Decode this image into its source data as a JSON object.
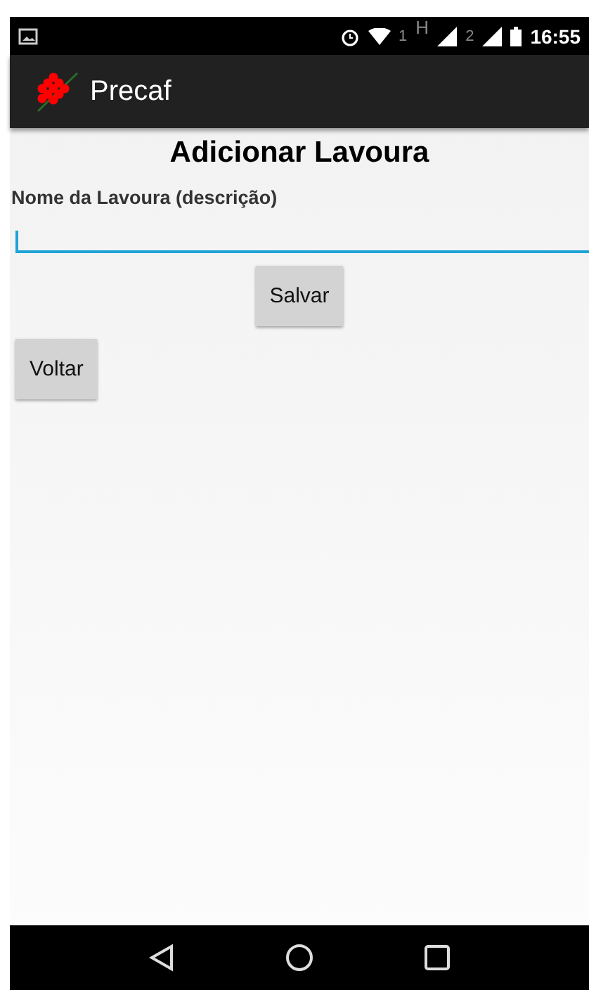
{
  "status_bar": {
    "sim1": "1",
    "network_type": "H",
    "sim2": "2",
    "time": "16:55"
  },
  "app_bar": {
    "title": "Precaf"
  },
  "page": {
    "heading": "Adicionar Lavoura",
    "field_label": "Nome da Lavoura (descrição)",
    "buttons": [
      {
        "kind": "centered",
        "label": "Salvar"
      },
      {
        "kind": "left",
        "label": "Voltar"
      }
    ]
  }
}
